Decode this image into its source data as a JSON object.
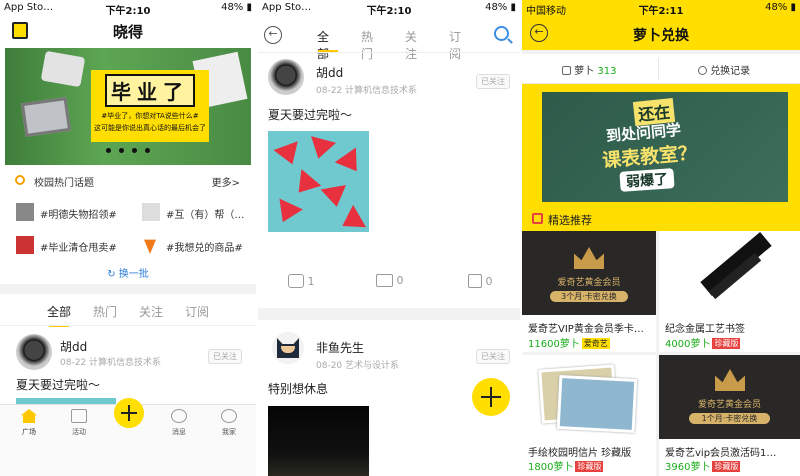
{
  "colors": {
    "accent": "#ffde00",
    "price": "#1aad19",
    "tag_red": "#e64340"
  },
  "screen1": {
    "status": {
      "left": "App Sto… ",
      "time": "下午2:10",
      "battery": "48%"
    },
    "title": "晓得",
    "banner": {
      "headline": "毕业了",
      "line1": "#毕业了，你想对TA说些什么#",
      "line2": "这可能是你说出真心话的最后机会了"
    },
    "hot": {
      "title": "校园热门话题",
      "more": "更多>"
    },
    "topics": [
      "#明德失物招领#",
      "#互（有）帮（…",
      "#毕业清仓甩卖#",
      "#我想兑的商品#"
    ],
    "refresh": "换一批",
    "tabs": [
      "全部",
      "热门",
      "关注",
      "订阅"
    ],
    "post": {
      "author": "胡dd",
      "meta": "08-22 计算机信息技术系",
      "followed": "已关注",
      "text": "夏天要过完啦～"
    },
    "nav": [
      "广场",
      "活动",
      "",
      "消息",
      "我家"
    ]
  },
  "screen2": {
    "status": {
      "left": "App Sto… ",
      "time": "下午2:10",
      "battery": "48%"
    },
    "tabs": [
      "全部",
      "热门",
      "关注",
      "订阅"
    ],
    "post1": {
      "author": "胡dd",
      "meta": "08-22 计算机信息技术系",
      "followed": "已关注",
      "text": "夏天要过完啦～",
      "likes": "1",
      "comments": "0",
      "shares": "0"
    },
    "post2": {
      "author": "非鱼先生",
      "meta": "08-20 艺术与设计系",
      "followed": "已关注",
      "text": "特别想休息"
    }
  },
  "screen3": {
    "status": {
      "left": "中国移动",
      "time": "下午2:11",
      "battery": "48%"
    },
    "title": "萝卜兑换",
    "balance_label": "萝卜",
    "balance_value": "313",
    "history": "兑换记录",
    "banner": {
      "line1": "还在",
      "line2": "到处问同学",
      "line3": "课表教室？",
      "line4": "弱爆了"
    },
    "section": "精选推荐",
    "products": [
      {
        "name": "爱奇艺VIP黄金会员季卡…",
        "price": "11600萝卜",
        "tag": "",
        "img_brand": "爱奇艺黄金会员",
        "img_sub": "3个月·卡密兑换"
      },
      {
        "name": "纪念金属工艺书签",
        "price": "4000萝卜",
        "tag": "珍藏版"
      },
      {
        "name": "手绘校园明信片 珍藏版",
        "price": "1800萝卜",
        "tag": "珍藏版"
      },
      {
        "name": "爱奇艺vip会员激活码1…",
        "price": "3960萝卜",
        "tag": "珍藏版",
        "img_brand": "爱奇艺黄金会员",
        "img_sub": "1个月·卡密兑换"
      }
    ],
    "tag_yellow": "爱奇艺"
  }
}
